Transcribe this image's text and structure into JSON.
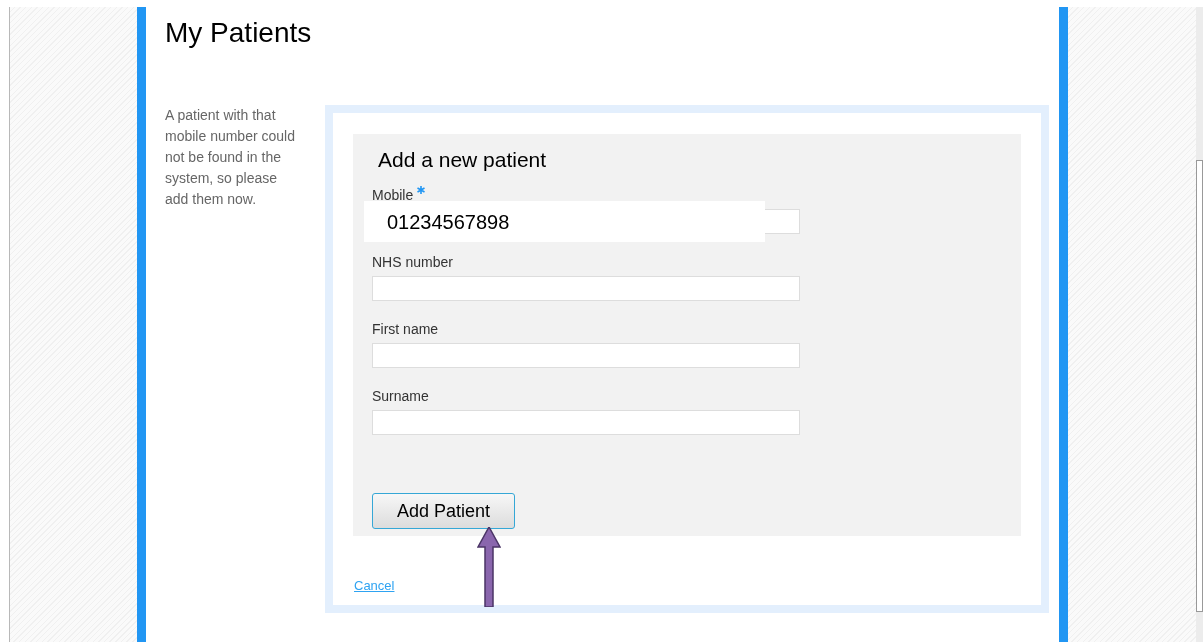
{
  "page": {
    "title": "My Patients"
  },
  "notice": "A patient with that mobile number could not be found in the system, so please add them now.",
  "form": {
    "title": "Add a new patient",
    "fields": [
      {
        "label": "Mobile",
        "required": true,
        "value": "01234567898"
      },
      {
        "label": "NHS number",
        "required": false
      },
      {
        "label": "First name",
        "required": false
      },
      {
        "label": "Surname",
        "required": false
      }
    ],
    "submit": "Add Patient",
    "cancel": "Cancel"
  }
}
